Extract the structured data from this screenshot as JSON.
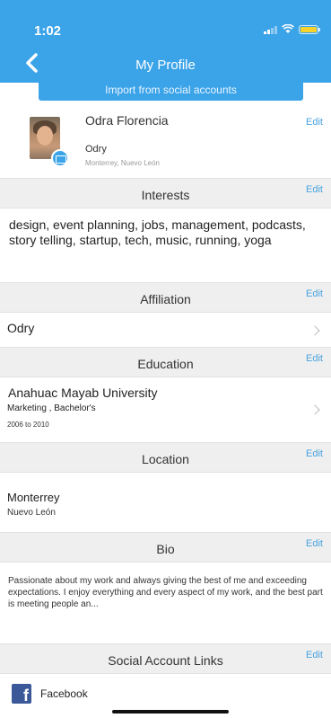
{
  "status": {
    "time": "1:02"
  },
  "header": {
    "title": "My Profile",
    "import_label": "Import from social accounts"
  },
  "profile": {
    "name": "Odra Florencia",
    "username": "Odry",
    "location": "Monterrey, Nuevo León",
    "edit_label": "Edit"
  },
  "sections": {
    "interests": {
      "title": "Interests",
      "edit_label": "Edit",
      "text": "design, event planning, jobs, management, podcasts, story telling, startup, tech, music, running, yoga"
    },
    "affiliation": {
      "title": "Affiliation",
      "edit_label": "Edit",
      "value": "Odry"
    },
    "education": {
      "title": "Education",
      "edit_label": "Edit",
      "school": "Anahuac Mayab University",
      "degree": "Marketing , Bachelor's",
      "years": "2006 to 2010"
    },
    "location": {
      "title": "Location",
      "edit_label": "Edit",
      "city": "Monterrey",
      "state": "Nuevo León"
    },
    "bio": {
      "title": "Bio",
      "edit_label": "Edit",
      "text": "Passionate about my work and always giving the best of me and exceeding expectations. I enjoy everything and every aspect of my work, and the best part is meeting people an..."
    },
    "social": {
      "title": "Social Account Links",
      "edit_label": "Edit",
      "facebook_label": "Facebook"
    }
  },
  "icons": {
    "back": "chevron-left-icon",
    "camera": "camera-icon",
    "facebook": "facebook-icon",
    "chevron": "chevron-right-icon"
  },
  "colors": {
    "accent": "#3ba3e8",
    "edit": "#4aa3df",
    "section_bg": "#efefef",
    "facebook": "#3b5998"
  }
}
